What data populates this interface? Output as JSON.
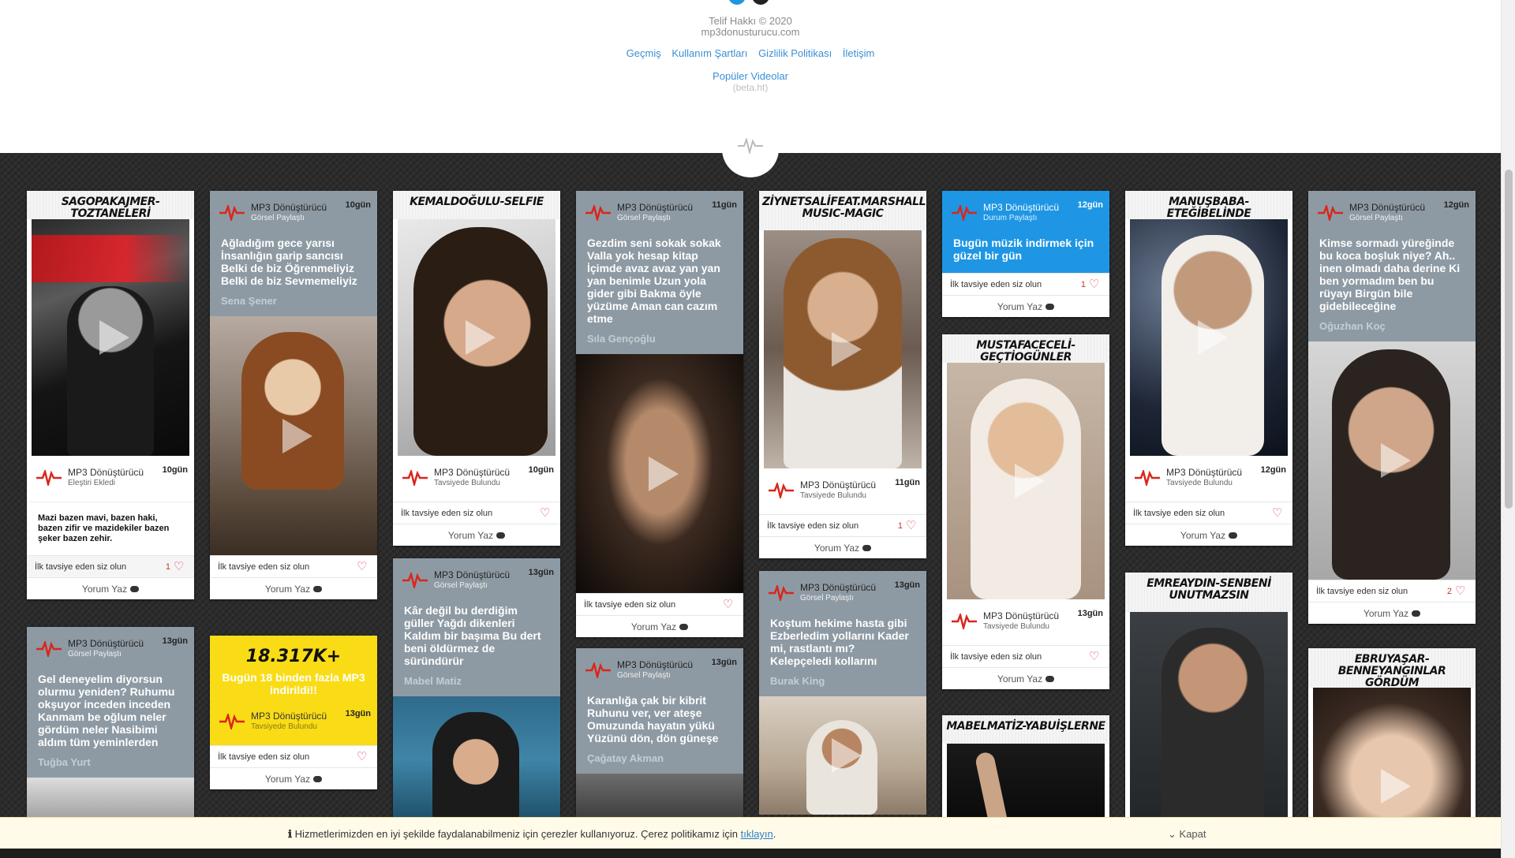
{
  "footer": {
    "copyright": "Telif Hakkı © 2020",
    "site": "mp3donusturucu.com",
    "links": [
      "Geçmiş",
      "Kullanım Şartları",
      "Gizlilik Politikası",
      "İletişim"
    ],
    "popular": "Popüler Videolar",
    "beta": "(beta.ht)"
  },
  "common": {
    "poster_name": "MP3 Dönüştürücü",
    "first_rec": "İlk tavsiye eden siz olun",
    "comment": "Yorum Yaz"
  },
  "cards": {
    "c1": {
      "title": "SAGOPAKAJMER-TOZTANELERİ",
      "type": "Eleştiri Ekledi",
      "time": "10gün",
      "review": "Mazi bazen mavi, bazen haki, bazen zifir ve mazidekiler bazen şeker bazen zehir.",
      "likes": "1"
    },
    "c2": {
      "type": "Görsel Paylaştı",
      "time": "10gün",
      "quote": "Ağladığım gece yarısı İnsanlığın garip sancısı Belki de biz Öğrenmeliyiz Belki de biz Sevmemeliyiz",
      "author": "Sena Şener"
    },
    "c3": {
      "title": "KEMALDOĞULU-SELFIE",
      "type": "Tavsiyede Bulundu",
      "time": "10gün"
    },
    "c4": {
      "type": "Görsel Paylaştı",
      "time": "11gün",
      "quote": "Gezdim seni sokak sokak Valla yok hesap kitap İçimde avaz avaz yan yan yan benimle Uzun yola gider gibi Bakma öyle yüzüme Aman can cazım etme",
      "author": "Sıla Gençoğlu"
    },
    "c5": {
      "title": "ZİYNETSALİFEAT.MARSHALL MUSIC-MAGIC",
      "type": "Tavsiyede Bulundu",
      "time": "11gün",
      "likes": "1"
    },
    "c6": {
      "type": "Durum Paylaştı",
      "time": "12gün",
      "quote": "Bugün müzik indirmek için güzel bir gün",
      "likes": "1"
    },
    "c7": {
      "title": "MANUŞBABA-ETEĞİBELİNDE",
      "type": "Tavsiyede Bulundu",
      "time": "12gün"
    },
    "c8": {
      "type": "Görsel Paylaştı",
      "time": "12gün",
      "quote": "Kimse sormadı yüreğinde bu koca boşluk niye? Ah.. inen olmadı daha derine Ki ben yormadım ben bu rüyayı Birgün bile gidebileceğine",
      "author": "Oğuzhan Koç",
      "likes": "2"
    },
    "c9": {
      "type": "Görsel Paylaştı",
      "time": "13gün",
      "quote": "Gel deneyelim diyorsun olurmu yeniden? Ruhumu okşuyor inceden inceden Kanmam be oğlum neler gördüm neler Nasibimi aldım tüm yeminlerden",
      "author": "Tuğba Yurt"
    },
    "c10": {
      "stat": "18.317K+",
      "text": "Bugün 18 binden fazla MP3 indirildi!!",
      "type": "Tavsiyede Bulundu",
      "time": "13gün"
    },
    "c11": {
      "type": "Görsel Paylaştı",
      "time": "13gün",
      "quote": "Kâr değil bu derdiğim güller Yağdı dikenleri Kaldım bir başıma Bu dert beni öldürmez de süründürür",
      "author": "Mabel Matiz"
    },
    "c12": {
      "type": "Görsel Paylaştı",
      "time": "13gün",
      "quote": "Karanlığa çak bir kibrit Ruhunu ver, ver ateşe Omuzunda hayatın yükü Yüzünü dön, dön güneşe",
      "author": "Çağatay Akman"
    },
    "c13": {
      "type": "Görsel Paylaştı",
      "time": "13gün",
      "quote": "Koştum hekime hasta gibi Ezberledim yollarını Kader mi, rastlantı mı? Kelepçeledi kollarını",
      "author": "Burak King"
    },
    "c14": {
      "title": "MUSTAFACECELİ-GEÇTİOGÜNLER",
      "type": "Tavsiyede Bulundu",
      "time": "13gün"
    },
    "c15": {
      "title": "MABELMATİZ-YABUİŞLERNE"
    },
    "c16": {
      "title": "EMREAYDIN-SENBENİ UNUTMAZSIN"
    },
    "c17": {
      "title": "EBRUYAŞAR-BENNEYANGINLAR GÖRDÜM"
    }
  },
  "cookie": {
    "message": "Hizmetlerimizden en iyi şekilde faydalanabilmeniz için çerezler kullanıyoruz. Çerez politikamız için",
    "link": "tıklayın",
    "close": "Kapat"
  },
  "colors": {
    "accent": "#2196d9",
    "grey_card": "#8e9aa3",
    "blue_card": "#1e96e4",
    "yellow_card": "#f9dc16",
    "board": "#2c2c2c"
  }
}
